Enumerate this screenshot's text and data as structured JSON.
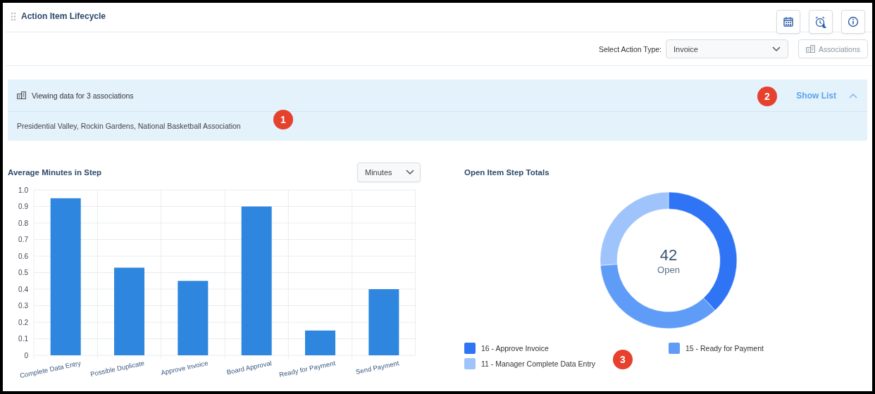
{
  "header": {
    "title": "Action Item Lifecycle"
  },
  "toolbar": {
    "action_type_label": "Select Action Type:",
    "action_type": {
      "value": "Invoice"
    },
    "associations_button": "Associations"
  },
  "banner": {
    "title": "Viewing data for 3 associations",
    "show_list": "Show List",
    "expanded": true,
    "associations": "Presidential Valley, Rockin Gardens, National Basketball Association"
  },
  "bar_panel": {
    "title": "Average Minutes in Step",
    "unit_select": {
      "value": "Minutes"
    },
    "chart_data": {
      "type": "bar",
      "categories": [
        "Complete Data Entry",
        "Possible Duplicate",
        "Approve Invoice",
        "Board Approval",
        "Ready for Payment",
        "Send Payment"
      ],
      "series": [
        {
          "color": "#2e86de",
          "values": [
            0.95,
            0.53,
            0.45,
            0.9,
            0.15,
            0.4
          ]
        }
      ],
      "grid": true,
      "ylim": [
        0,
        1
      ],
      "yticks": [
        {
          "value": 0,
          "label": "0"
        },
        {
          "value": 0.1,
          "label": "0.1"
        },
        {
          "value": 0.2,
          "label": "0.2"
        },
        {
          "value": 0.3,
          "label": "0.3"
        },
        {
          "value": 0.4,
          "label": "0.4"
        },
        {
          "value": 0.5,
          "label": "0.5"
        },
        {
          "value": 0.6,
          "label": "0.6"
        },
        {
          "value": 0.7,
          "label": "0.7"
        },
        {
          "value": 0.8,
          "label": "0.8"
        },
        {
          "value": 0.9,
          "label": "0.9"
        },
        {
          "value": 1,
          "label": "1.0"
        }
      ]
    }
  },
  "donut_panel": {
    "title": "Open Item Step Totals",
    "total": "42",
    "total_label": "Open",
    "chart_data": {
      "type": "donut",
      "categories": [
        "16 - Approve Invoice",
        "15 - Ready for Payment",
        "11 - Manager Complete Data Entry"
      ],
      "series": [
        {
          "values": [
            16,
            15,
            11
          ]
        }
      ]
    },
    "legend": [
      {
        "color": "#2f74f5"
      },
      {
        "color": "#5f9cf8"
      },
      {
        "color": "#9fc4fb"
      }
    ]
  },
  "callouts": [
    "1",
    "2",
    "3"
  ]
}
